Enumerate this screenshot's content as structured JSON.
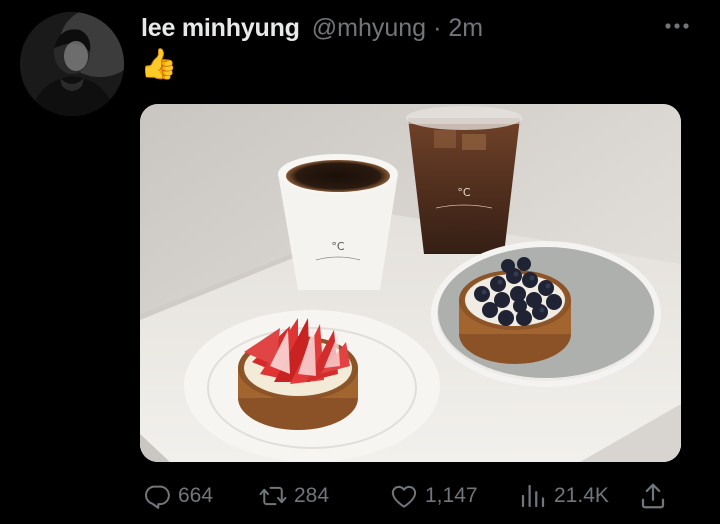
{
  "tweet": {
    "display_name": "lee minhyung",
    "handle": "@mhyung",
    "separator": "·",
    "time": "2m",
    "text": "👍",
    "more_icon": "more-horizontal-icon"
  },
  "actions": {
    "reply": {
      "icon": "reply-icon",
      "count": "664"
    },
    "retweet": {
      "icon": "retweet-icon",
      "count": "284"
    },
    "like": {
      "icon": "heart-icon",
      "count": "1,147"
    },
    "views": {
      "icon": "views-chart-icon",
      "count": "21.4K"
    },
    "share": {
      "icon": "share-icon"
    }
  },
  "media": {
    "cup_logo": "°C"
  },
  "colors": {
    "background": "#000000",
    "primary_text": "#e7e9ea",
    "secondary_text": "#71767b"
  }
}
